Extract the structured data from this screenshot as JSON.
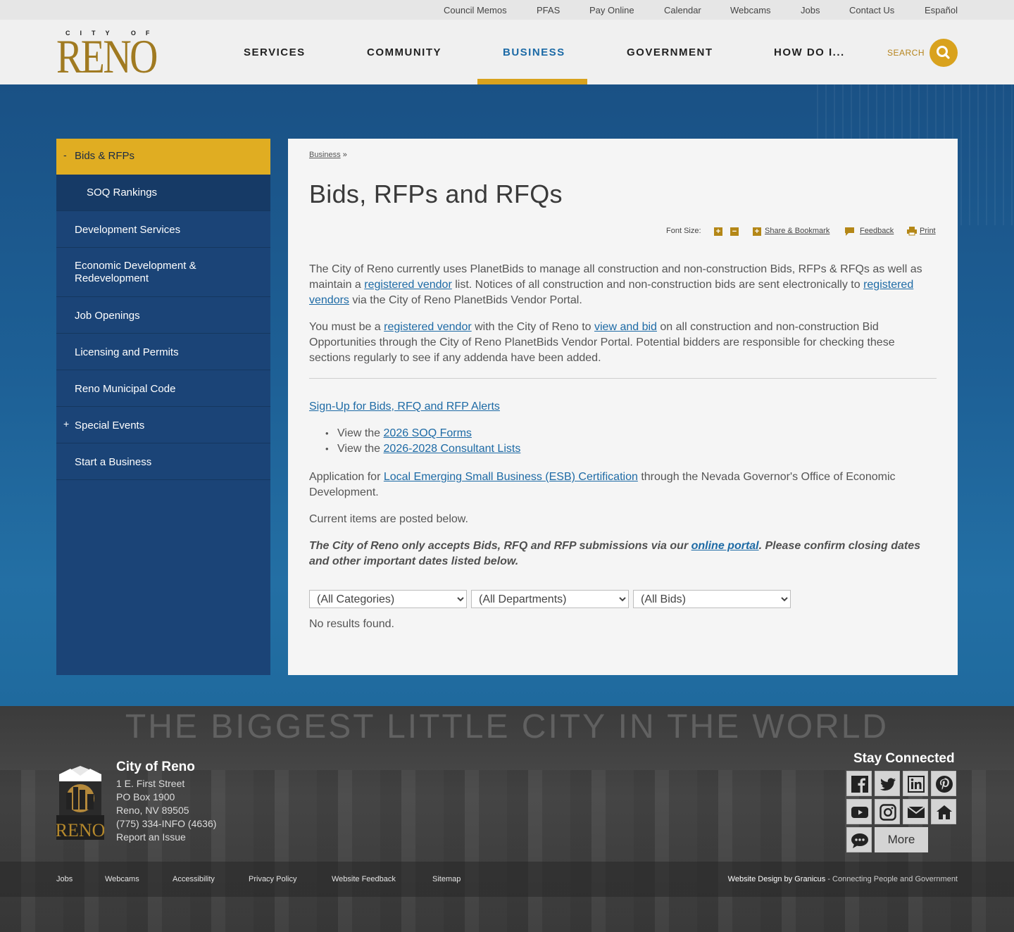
{
  "utility_nav": [
    "Council Memos",
    "PFAS",
    "Pay Online",
    "Calendar",
    "Webcams",
    "Jobs",
    "Contact Us",
    "Español"
  ],
  "logo": {
    "city_of": "CITY OF",
    "name": "RENO"
  },
  "main_nav": [
    {
      "label": "SERVICES",
      "active": false
    },
    {
      "label": "COMMUNITY",
      "active": false
    },
    {
      "label": "BUSINESS",
      "active": true
    },
    {
      "label": "GOVERNMENT",
      "active": false
    },
    {
      "label": "HOW DO I...",
      "active": false
    }
  ],
  "search": {
    "label": "SEARCH",
    "icon": "search-icon"
  },
  "sidebar": [
    {
      "label": "Bids & RFPs",
      "marker": "-",
      "state": "active"
    },
    {
      "label": "SOQ Rankings",
      "marker": "",
      "state": "sub"
    },
    {
      "label": "Development Services",
      "marker": "",
      "state": "normal"
    },
    {
      "label": "Economic Development & Redevelopment",
      "marker": "",
      "state": "normal"
    },
    {
      "label": "Job Openings",
      "marker": "",
      "state": "normal"
    },
    {
      "label": "Licensing and Permits",
      "marker": "",
      "state": "normal"
    },
    {
      "label": "Reno Municipal Code",
      "marker": "",
      "state": "normal"
    },
    {
      "label": "Special Events",
      "marker": "+",
      "state": "normal"
    },
    {
      "label": "Start a Business",
      "marker": "",
      "state": "normal"
    }
  ],
  "breadcrumb": {
    "link": "Business",
    "separator": "»"
  },
  "page_title": "Bids, RFPs and RFQs",
  "tools": {
    "font_size": "Font Size:",
    "share": "Share & Bookmark",
    "feedback": "Feedback",
    "print": "Print"
  },
  "content": {
    "p1": [
      "The City of Reno currently uses PlanetBids to manage all construction and non-construction Bids, RFPs & RFQs as well as maintain a ",
      "registered vendor",
      " list. Notices of all construction and non-construction bids are sent electronically to ",
      "registered vendors",
      " via the City of Reno PlanetBids Vendor Portal."
    ],
    "p2": [
      "You must be a ",
      "registered vendor",
      " with the City of Reno to ",
      "view and bid",
      " on all construction and non-construction Bid Opportunities through the City of Reno PlanetBids Vendor Portal. Potential bidders are responsible for checking these sections regularly to see if any addenda have been added."
    ],
    "signup": "Sign-Up for Bids, RFQ and RFP Alerts",
    "bullets": [
      {
        "prefix": "View the ",
        "link": "2026 SOQ Forms"
      },
      {
        "prefix": "View the ",
        "link": "2026-2028 Consultant Lists"
      }
    ],
    "p3": [
      "Application for ",
      "Local Emerging Small Business (ESB) Certification",
      " through the Nevada Governor's Office of Economic Development."
    ],
    "p4": "Current items are posted below.",
    "p5": [
      "The City of Reno only accepts Bids, RFQ and RFP submissions via our ",
      "online portal",
      ".  Please confirm closing dates and other important dates listed below."
    ],
    "filters": [
      "(All Categories)",
      "(All Departments)",
      "(All Bids)"
    ],
    "no_results": "No results found."
  },
  "footer": {
    "motto": "THE BIGGEST LITTLE CITY IN THE WORLD",
    "org": "City of Reno",
    "address": [
      "1 E. First Street",
      "PO Box 1900",
      "Reno, NV 89505",
      "(775) 334-INFO (4636)",
      "Report an Issue"
    ],
    "stay_connected": "Stay Connected",
    "social": [
      "facebook-icon",
      "twitter-icon",
      "linkedin-icon",
      "pinterest-icon",
      "youtube-icon",
      "instagram-icon",
      "email-icon",
      "nextdoor-icon",
      "chat-icon"
    ],
    "more": "More",
    "links": [
      "Jobs",
      "Webcams",
      "Accessibility",
      "Privacy Policy",
      "Website Feedback",
      "Sitemap"
    ],
    "credit_strong": "Website Design by Granicus",
    "credit_rest": " - Connecting People and Government"
  }
}
